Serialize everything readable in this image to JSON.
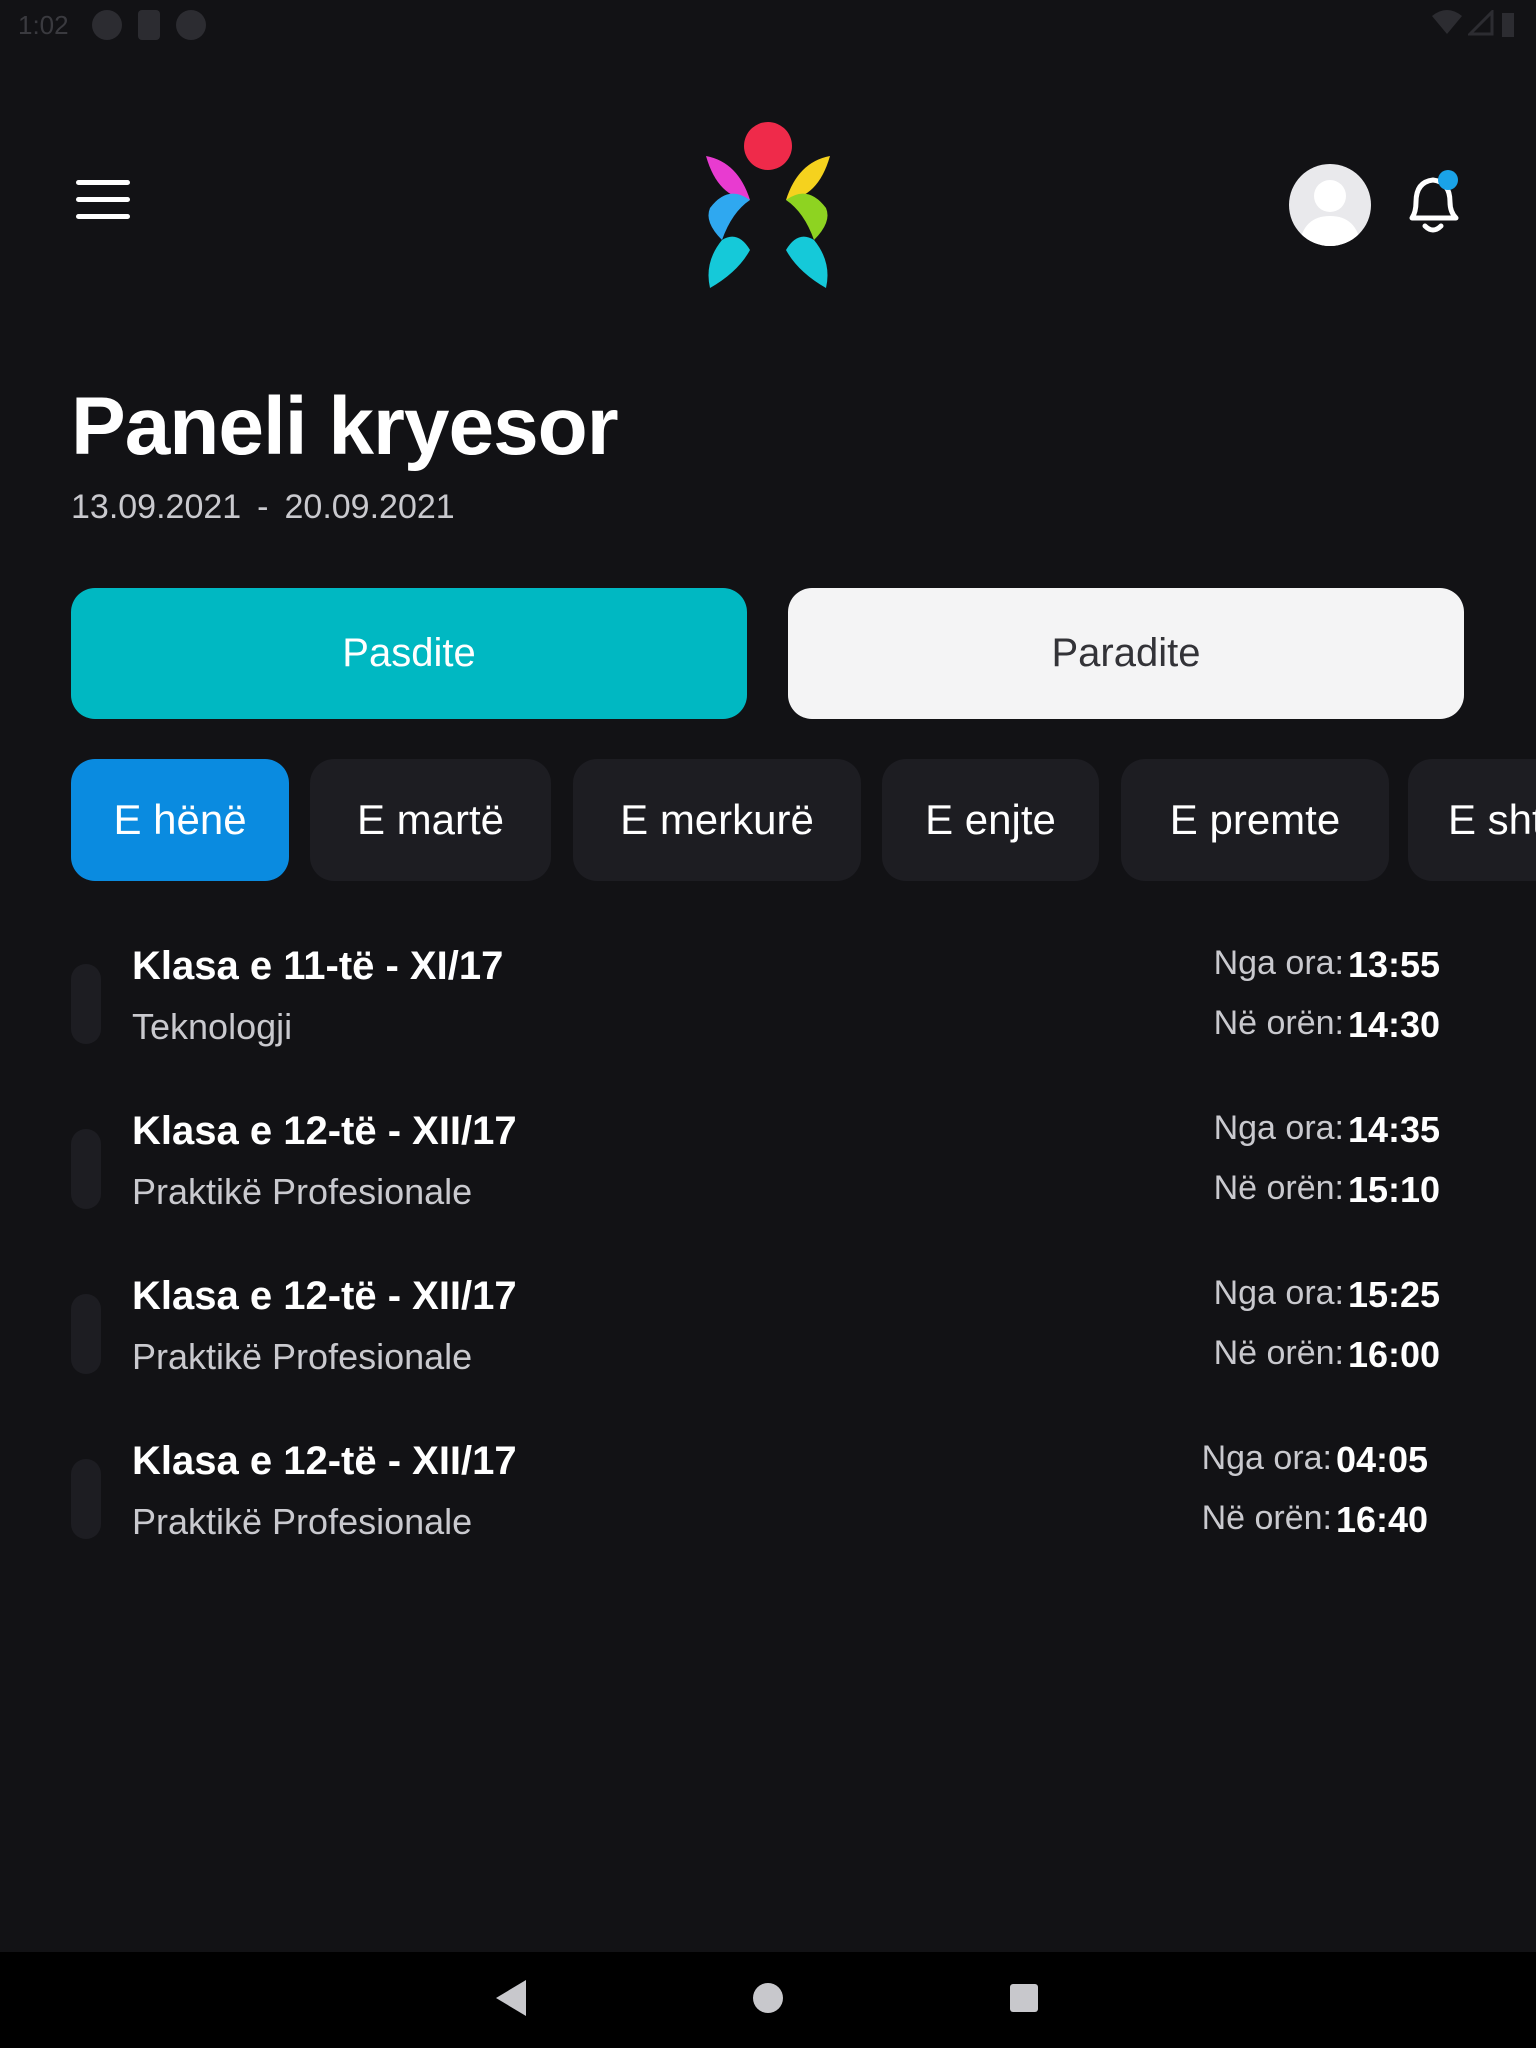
{
  "status_bar": {
    "time": "1:02"
  },
  "header": {
    "menu_icon": "hamburger-menu-icon",
    "logo": "colorful-petal-logo",
    "avatar_icon": "user-avatar-icon",
    "notification_icon": "bell-icon",
    "notification_dot_color": "#1aa3e8"
  },
  "page": {
    "title": "Paneli kryesor",
    "date_from": "13.09.2021",
    "date_sep": "-",
    "date_to": "20.09.2021"
  },
  "shift_toggle": {
    "active_label": "Pasdite",
    "inactive_label": "Paradite",
    "active_color": "#00b8c2"
  },
  "day_tabs": [
    {
      "label": "E hënë",
      "active": true
    },
    {
      "label": "E martë",
      "active": false
    },
    {
      "label": "E merkurë",
      "active": false
    },
    {
      "label": "E enjte",
      "active": false
    },
    {
      "label": "E premte",
      "active": false
    },
    {
      "label": "E sht",
      "active": false
    }
  ],
  "schedule": {
    "from_label": "Nga ora:",
    "to_label": "Në orën:",
    "items": [
      {
        "class_name": "Klasa e 11-të - XI/17",
        "subject": "Teknologji",
        "from": "13:55",
        "to": "14:30"
      },
      {
        "class_name": "Klasa e 12-të - XII/17",
        "subject": "Praktikë Profesionale",
        "from": "14:35",
        "to": "15:10"
      },
      {
        "class_name": "Klasa e 12-të - XII/17",
        "subject": "Praktikë Profesionale",
        "from": "15:25",
        "to": "16:00"
      },
      {
        "class_name": "Klasa e 12-të - XII/17",
        "subject": "Praktikë Profesionale",
        "from": "04:05",
        "to": "16:40"
      }
    ]
  },
  "nav_bar": {
    "back_icon": "back-triangle-icon",
    "home_icon": "home-circle-icon",
    "recents_icon": "recents-square-icon"
  }
}
